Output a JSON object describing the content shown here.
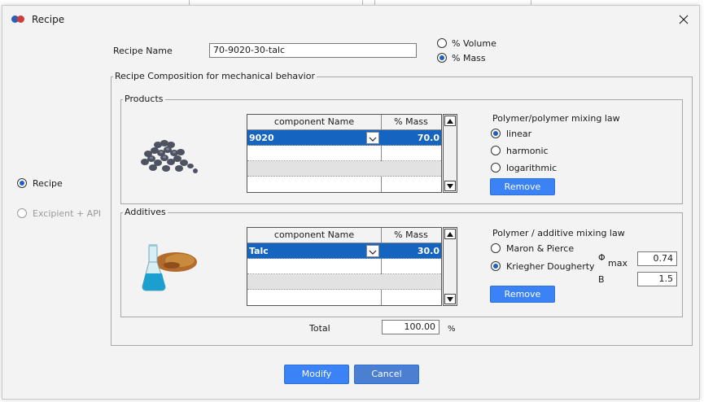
{
  "window": {
    "title": "Recipe"
  },
  "recipe_name": {
    "label": "Recipe Name",
    "value": "70-9020-30-talc"
  },
  "basis": {
    "options": [
      "% Volume",
      "% Mass"
    ],
    "selected": "% Mass"
  },
  "left_nav": {
    "items": [
      {
        "label": "Recipe",
        "selected": true
      },
      {
        "label": "Excipient + API",
        "selected": false
      }
    ]
  },
  "composition": {
    "title": "Recipe Composition for mechanical behavior"
  },
  "products": {
    "title": "Products",
    "columns": [
      "component Name",
      "% Mass"
    ],
    "rows": [
      {
        "name": "9020",
        "mass": "70.0"
      }
    ],
    "law_title": "Polymer/polymer mixing law",
    "laws": [
      "linear",
      "harmonic",
      "logarithmic"
    ],
    "selected_law": "linear",
    "remove_label": "Remove"
  },
  "additives": {
    "title": "Additives",
    "columns": [
      "component Name",
      "% Mass"
    ],
    "rows": [
      {
        "name": "Talc",
        "mass": "30.0"
      }
    ],
    "law_title": "Polymer / additive mixing law",
    "laws": [
      "Maron & Pierce",
      "Kriegher Dougherty"
    ],
    "selected_law": "Kriegher Dougherty",
    "phi_symbol": "Φ",
    "phi_sub": "max",
    "phi_value": "0.74",
    "b_label": "B",
    "b_value": "1.5",
    "remove_label": "Remove"
  },
  "total": {
    "label": "Total",
    "value": "100.00",
    "unit": "%"
  },
  "footer": {
    "modify_label": "Modify",
    "cancel_label": "Cancel"
  },
  "colors": {
    "accent": "#3b82f6",
    "selection": "#1565c0"
  }
}
